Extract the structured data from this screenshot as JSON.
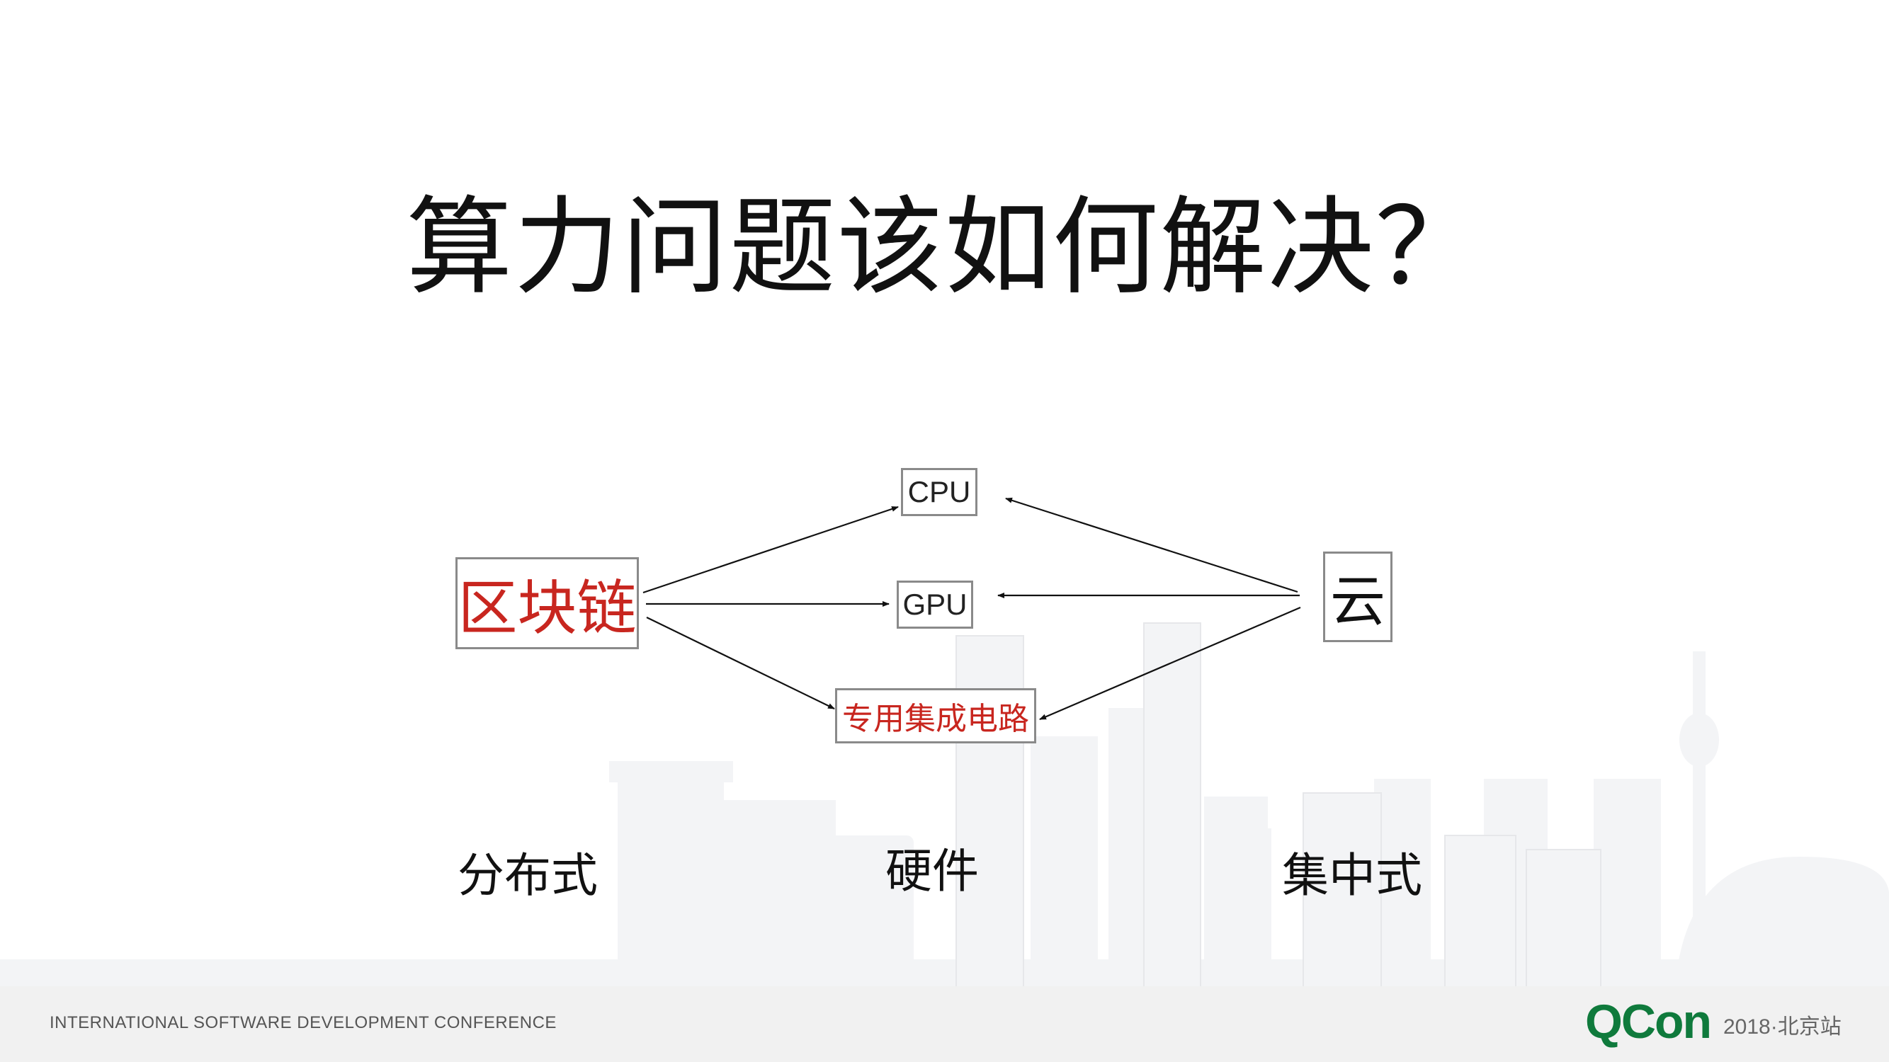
{
  "title": "算力问题该如何解决？",
  "nodes": {
    "cpu": "CPU",
    "gpu": "GPU",
    "asic": "专用集成电路",
    "blockchain": "区块链",
    "cloud": "云"
  },
  "categories": {
    "distributed": "分布式",
    "hardware": "硬件",
    "centralized": "集中式"
  },
  "edges": [
    {
      "from": "区块链",
      "to": "CPU"
    },
    {
      "from": "区块链",
      "to": "GPU"
    },
    {
      "from": "区块链",
      "to": "专用集成电路"
    },
    {
      "from": "云",
      "to": "CPU"
    },
    {
      "from": "云",
      "to": "GPU"
    },
    {
      "from": "云",
      "to": "专用集成电路"
    }
  ],
  "footer": {
    "conference": "INTERNATIONAL SOFTWARE DEVELOPMENT CONFERENCE",
    "logo": "QCon",
    "edition": "2018·北京站"
  },
  "colors": {
    "accent_red": "#c8261f",
    "logo_green": "#0f7a3c",
    "footer_bg": "#f1f1f1"
  }
}
